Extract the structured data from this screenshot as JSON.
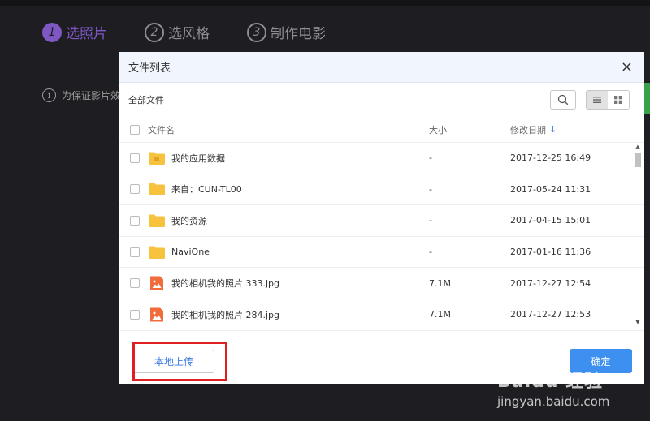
{
  "steps": [
    {
      "num": "1",
      "label": "选照片"
    },
    {
      "num": "2",
      "label": "选风格"
    },
    {
      "num": "3",
      "label": "制作电影"
    }
  ],
  "notice": {
    "text": "为保证影片效"
  },
  "dialog": {
    "title": "文件列表",
    "close": "×",
    "breadcrumb": "全部文件",
    "columns": {
      "name": "文件名",
      "size": "大小",
      "date": "修改日期"
    },
    "sort_arrow": "↓",
    "files": [
      {
        "type": "folder",
        "name": "我的应用数据",
        "size": "-",
        "date": "2017-12-25 16:49"
      },
      {
        "type": "folder",
        "name": "来自：CUN-TL00",
        "size": "-",
        "date": "2017-05-24 11:31"
      },
      {
        "type": "folder",
        "name": "我的资源",
        "size": "-",
        "date": "2017-04-15 15:01"
      },
      {
        "type": "folder",
        "name": "NaviOne",
        "size": "-",
        "date": "2017-01-16 11:36"
      },
      {
        "type": "image",
        "name": "我的相机我的照片 333.jpg",
        "size": "7.1M",
        "date": "2017-12-27 12:54"
      },
      {
        "type": "image",
        "name": "我的相机我的照片 284.jpg",
        "size": "7.1M",
        "date": "2017-12-27 12:53"
      }
    ],
    "upload_label": "本地上传",
    "confirm_label": "确定"
  },
  "watermark": {
    "logo": "Baidu 经验",
    "url": "jingyan.baidu.com"
  },
  "colors": {
    "accent_purple": "#7e57c2",
    "primary_blue": "#3d8ff0",
    "folder_yellow": "#f7c23e",
    "image_orange": "#f26b3a",
    "highlight_red": "#e02020"
  }
}
